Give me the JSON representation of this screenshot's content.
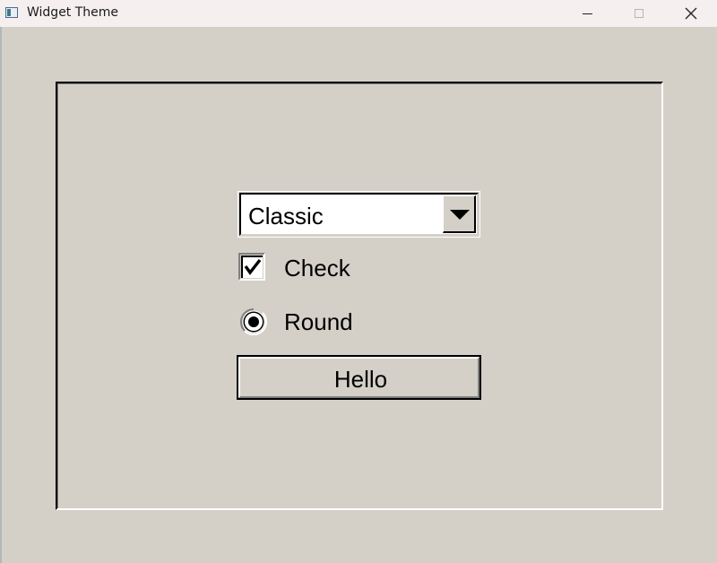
{
  "window": {
    "title": "Widget Theme",
    "app_icon": "window-app-icon",
    "controls": {
      "minimize_icon": "minimize-icon",
      "maximize_icon": "maximize-icon",
      "close_icon": "close-icon",
      "close_glyph": "✕"
    }
  },
  "combobox": {
    "selected_value": "Classic",
    "arrow_icon": "dropdown-arrow-icon"
  },
  "checkbox": {
    "label": "Check",
    "checked": true
  },
  "radio": {
    "label": "Round",
    "selected": true
  },
  "button": {
    "label": "Hello"
  },
  "colors": {
    "window_background": "#d4d0c8",
    "titlebar_background": "#f6efef",
    "text": "#000000"
  }
}
